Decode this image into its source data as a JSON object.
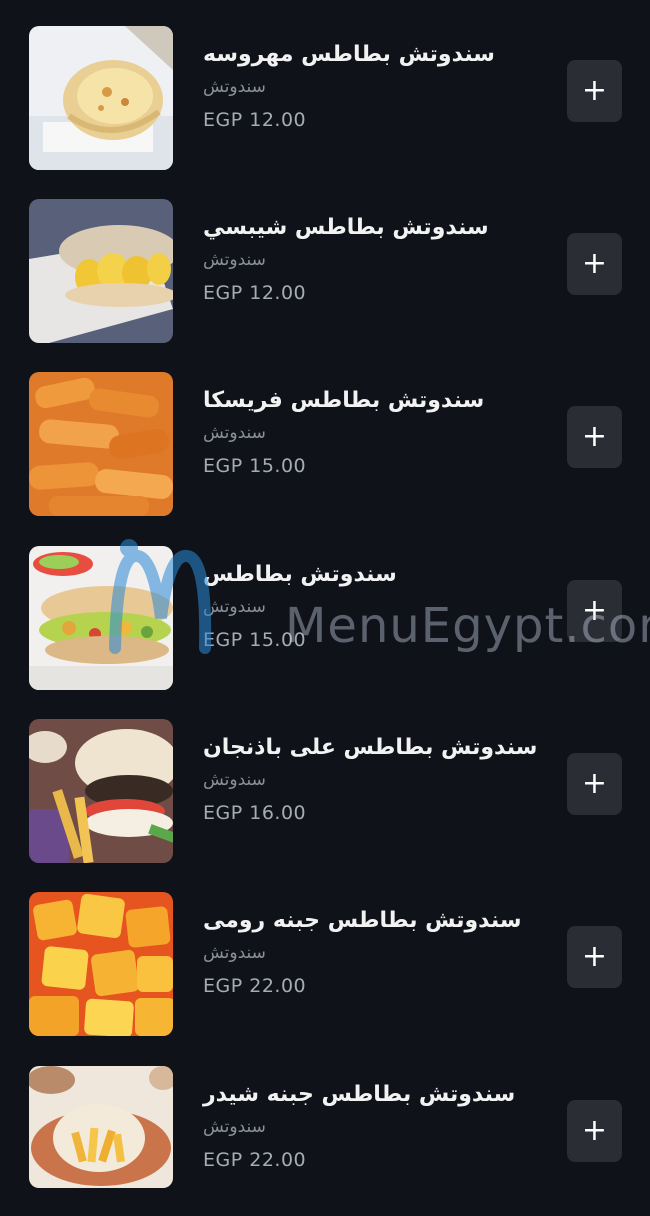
{
  "colors": {
    "background": "#0f1218",
    "add_button_bg": "#2a2d33",
    "text_primary": "#f2f2f2",
    "text_secondary": "#8a8f98",
    "price_text": "#a7acb4"
  },
  "menu_items": [
    {
      "name": "سندوتش بطاطس مهروسه",
      "category": "سندوتش",
      "price": "EGP 12.00",
      "image": "mashed-potato-sandwich-photo",
      "add_icon": "+"
    },
    {
      "name": "سندوتش بطاطس شيبسي",
      "category": "سندوتش",
      "price": "EGP 12.00",
      "image": "chips-sandwich-photo",
      "add_icon": "+"
    },
    {
      "name": "سندوتش بطاطس فريسكا",
      "category": "سندوتش",
      "price": "EGP 15.00",
      "image": "fries-sandwich-photo",
      "add_icon": "+"
    },
    {
      "name": "سندوتش بطاطس",
      "category": "سندوتش",
      "price": "EGP 15.00",
      "image": "potato-sandwich-photo",
      "add_icon": "+"
    },
    {
      "name": "سندوتش بطاطس على باذنجان",
      "category": "سندوتش",
      "price": "EGP 16.00",
      "image": "eggplant-sandwich-photo",
      "add_icon": "+"
    },
    {
      "name": "سندوتش بطاطس جبنه رومى",
      "category": "سندوتش",
      "price": "EGP 22.00",
      "image": "romy-cheese-potato-photo",
      "add_icon": "+"
    },
    {
      "name": "سندوتش بطاطس جبنه شيدر",
      "category": "سندوتش",
      "price": "EGP 22.00",
      "image": "cheddar-potato-sandwich-photo",
      "add_icon": "+"
    }
  ],
  "watermark": {
    "text": "MenuEgypt.com"
  }
}
